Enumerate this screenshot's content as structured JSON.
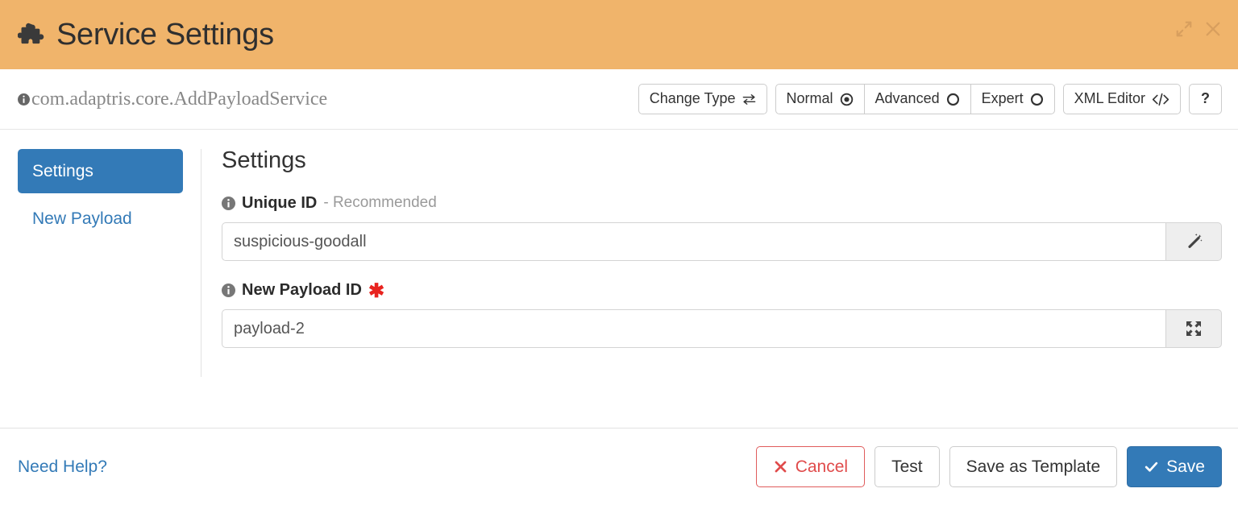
{
  "window": {
    "title": "Service Settings",
    "icon": "puzzle-piece-icon",
    "expand_label": "",
    "close_label": "",
    "header_color": "#f0b46b"
  },
  "type_bar": {
    "class_name": "com.adaptris.core.AddPayloadService",
    "info_icon": "info-circle-icon",
    "change_type": {
      "label": "Change Type",
      "icon": "exchange-icon"
    },
    "modes": [
      {
        "label": "Normal",
        "icon": "radio-selected-icon",
        "selected": true
      },
      {
        "label": "Advanced",
        "icon": "radio-unselected-icon",
        "selected": false
      },
      {
        "label": "Expert",
        "icon": "radio-unselected-icon",
        "selected": false
      }
    ],
    "xml_editor": {
      "label": "XML Editor",
      "icon": "code-icon"
    },
    "help": {
      "label": "?"
    }
  },
  "sidebar": {
    "items": [
      {
        "label": "Settings",
        "active": true
      },
      {
        "label": "New Payload",
        "active": false
      }
    ]
  },
  "main": {
    "title": "Settings",
    "fields": [
      {
        "label_main": "Unique ID",
        "label_sub": "- Recommended",
        "required": false,
        "value": "suspicious-goodall",
        "placeholder": "",
        "addon_icon": "magic-wand-icon",
        "info_icon": "info-circle-icon"
      },
      {
        "label_main": "New Payload ID",
        "label_sub": "",
        "required": true,
        "required_mark": "✱",
        "value": "payload-2",
        "placeholder": "",
        "addon_icon": "arrows-alt-icon",
        "info_icon": "info-circle-icon"
      }
    ]
  },
  "footer": {
    "need_help": "Need Help?",
    "buttons": [
      {
        "label": "Cancel",
        "style": "danger",
        "icon": "times-icon"
      },
      {
        "label": "Test",
        "style": "default",
        "icon": ""
      },
      {
        "label": "Save as Template",
        "style": "default",
        "icon": ""
      },
      {
        "label": "Save",
        "style": "primary",
        "icon": "check-icon"
      }
    ]
  },
  "colors": {
    "header": "#f0b46b",
    "primary": "#337ab7",
    "danger": "#e04b4b",
    "required": "#e8231f"
  }
}
